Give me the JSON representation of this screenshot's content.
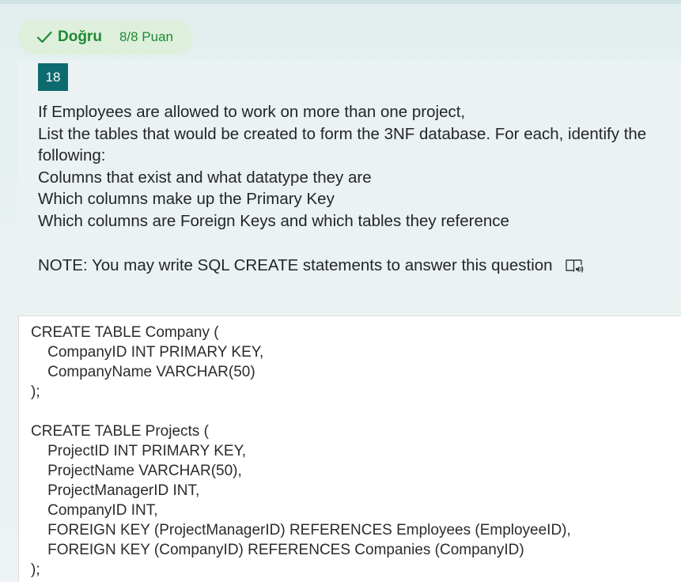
{
  "result": {
    "status": "Doğru",
    "points": "8/8 Puan",
    "color": "#1e8a33"
  },
  "question": {
    "number": "18",
    "lines": [
      "If Employees are allowed to work on more than one project,",
      "List the tables that would be created to form the 3NF database. For each, identify the following:",
      "Columns that exist and what datatype they are",
      "Which columns make up the Primary Key",
      "Which columns are Foreign Keys and which tables they reference"
    ],
    "note": "NOTE: You may write SQL CREATE statements to answer this question",
    "reader_icon": "immersive-reader-icon"
  },
  "answer": {
    "lines": [
      "CREATE TABLE Company (",
      "    CompanyID INT PRIMARY KEY,",
      "    CompanyName VARCHAR(50)",
      ");",
      "",
      "CREATE TABLE Projects (",
      "    ProjectID INT PRIMARY KEY,",
      "    ProjectName VARCHAR(50),",
      "    ProjectManagerID INT,",
      "    CompanyID INT,",
      "    FOREIGN KEY (ProjectManagerID) REFERENCES Employees (EmployeeID),",
      "    FOREIGN KEY (CompanyID) REFERENCES Companies (CompanyID)",
      ");"
    ]
  },
  "colors": {
    "accent": "#0d6b6f",
    "success": "#1e8a33",
    "success_bg": "#def0dc"
  }
}
